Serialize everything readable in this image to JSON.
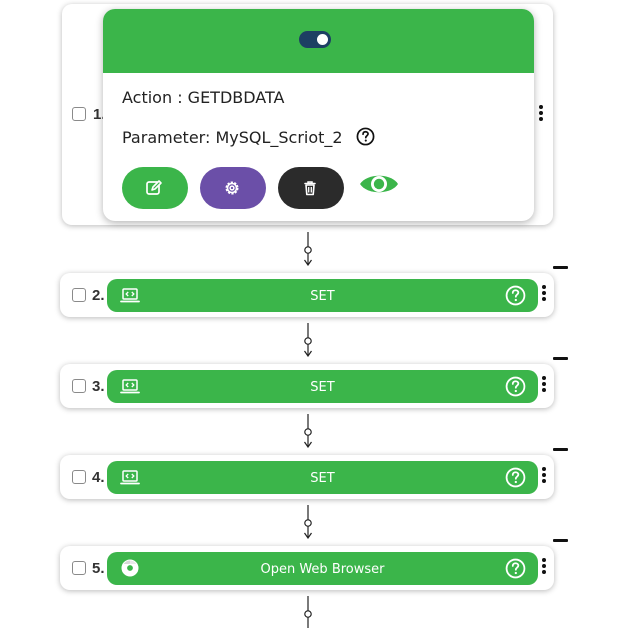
{
  "step1": {
    "number": "1.",
    "action_line": "Action : GETDBDATA",
    "parameter_line": "Parameter: MySQL_Scriot_2",
    "toggle_state": "on",
    "buttons": [
      {
        "name": "edit",
        "color": "#3bb54a"
      },
      {
        "name": "settings",
        "color": "#6b4fa8"
      },
      {
        "name": "delete",
        "color": "#2b2b2b"
      },
      {
        "name": "view",
        "color": "#3bb54a"
      }
    ]
  },
  "steps": [
    {
      "number": "2.",
      "label": "SET",
      "icon": "code-laptop-icon"
    },
    {
      "number": "3.",
      "label": "SET",
      "icon": "code-laptop-icon"
    },
    {
      "number": "4.",
      "label": "SET",
      "icon": "code-laptop-icon"
    },
    {
      "number": "5.",
      "label": "Open Web Browser",
      "icon": "chrome-icon"
    }
  ],
  "colors": {
    "accent_green": "#3bb54a",
    "toggle_navy": "#1d3f63",
    "settings_purple": "#6b4fa8",
    "delete_dark": "#2b2b2b"
  }
}
